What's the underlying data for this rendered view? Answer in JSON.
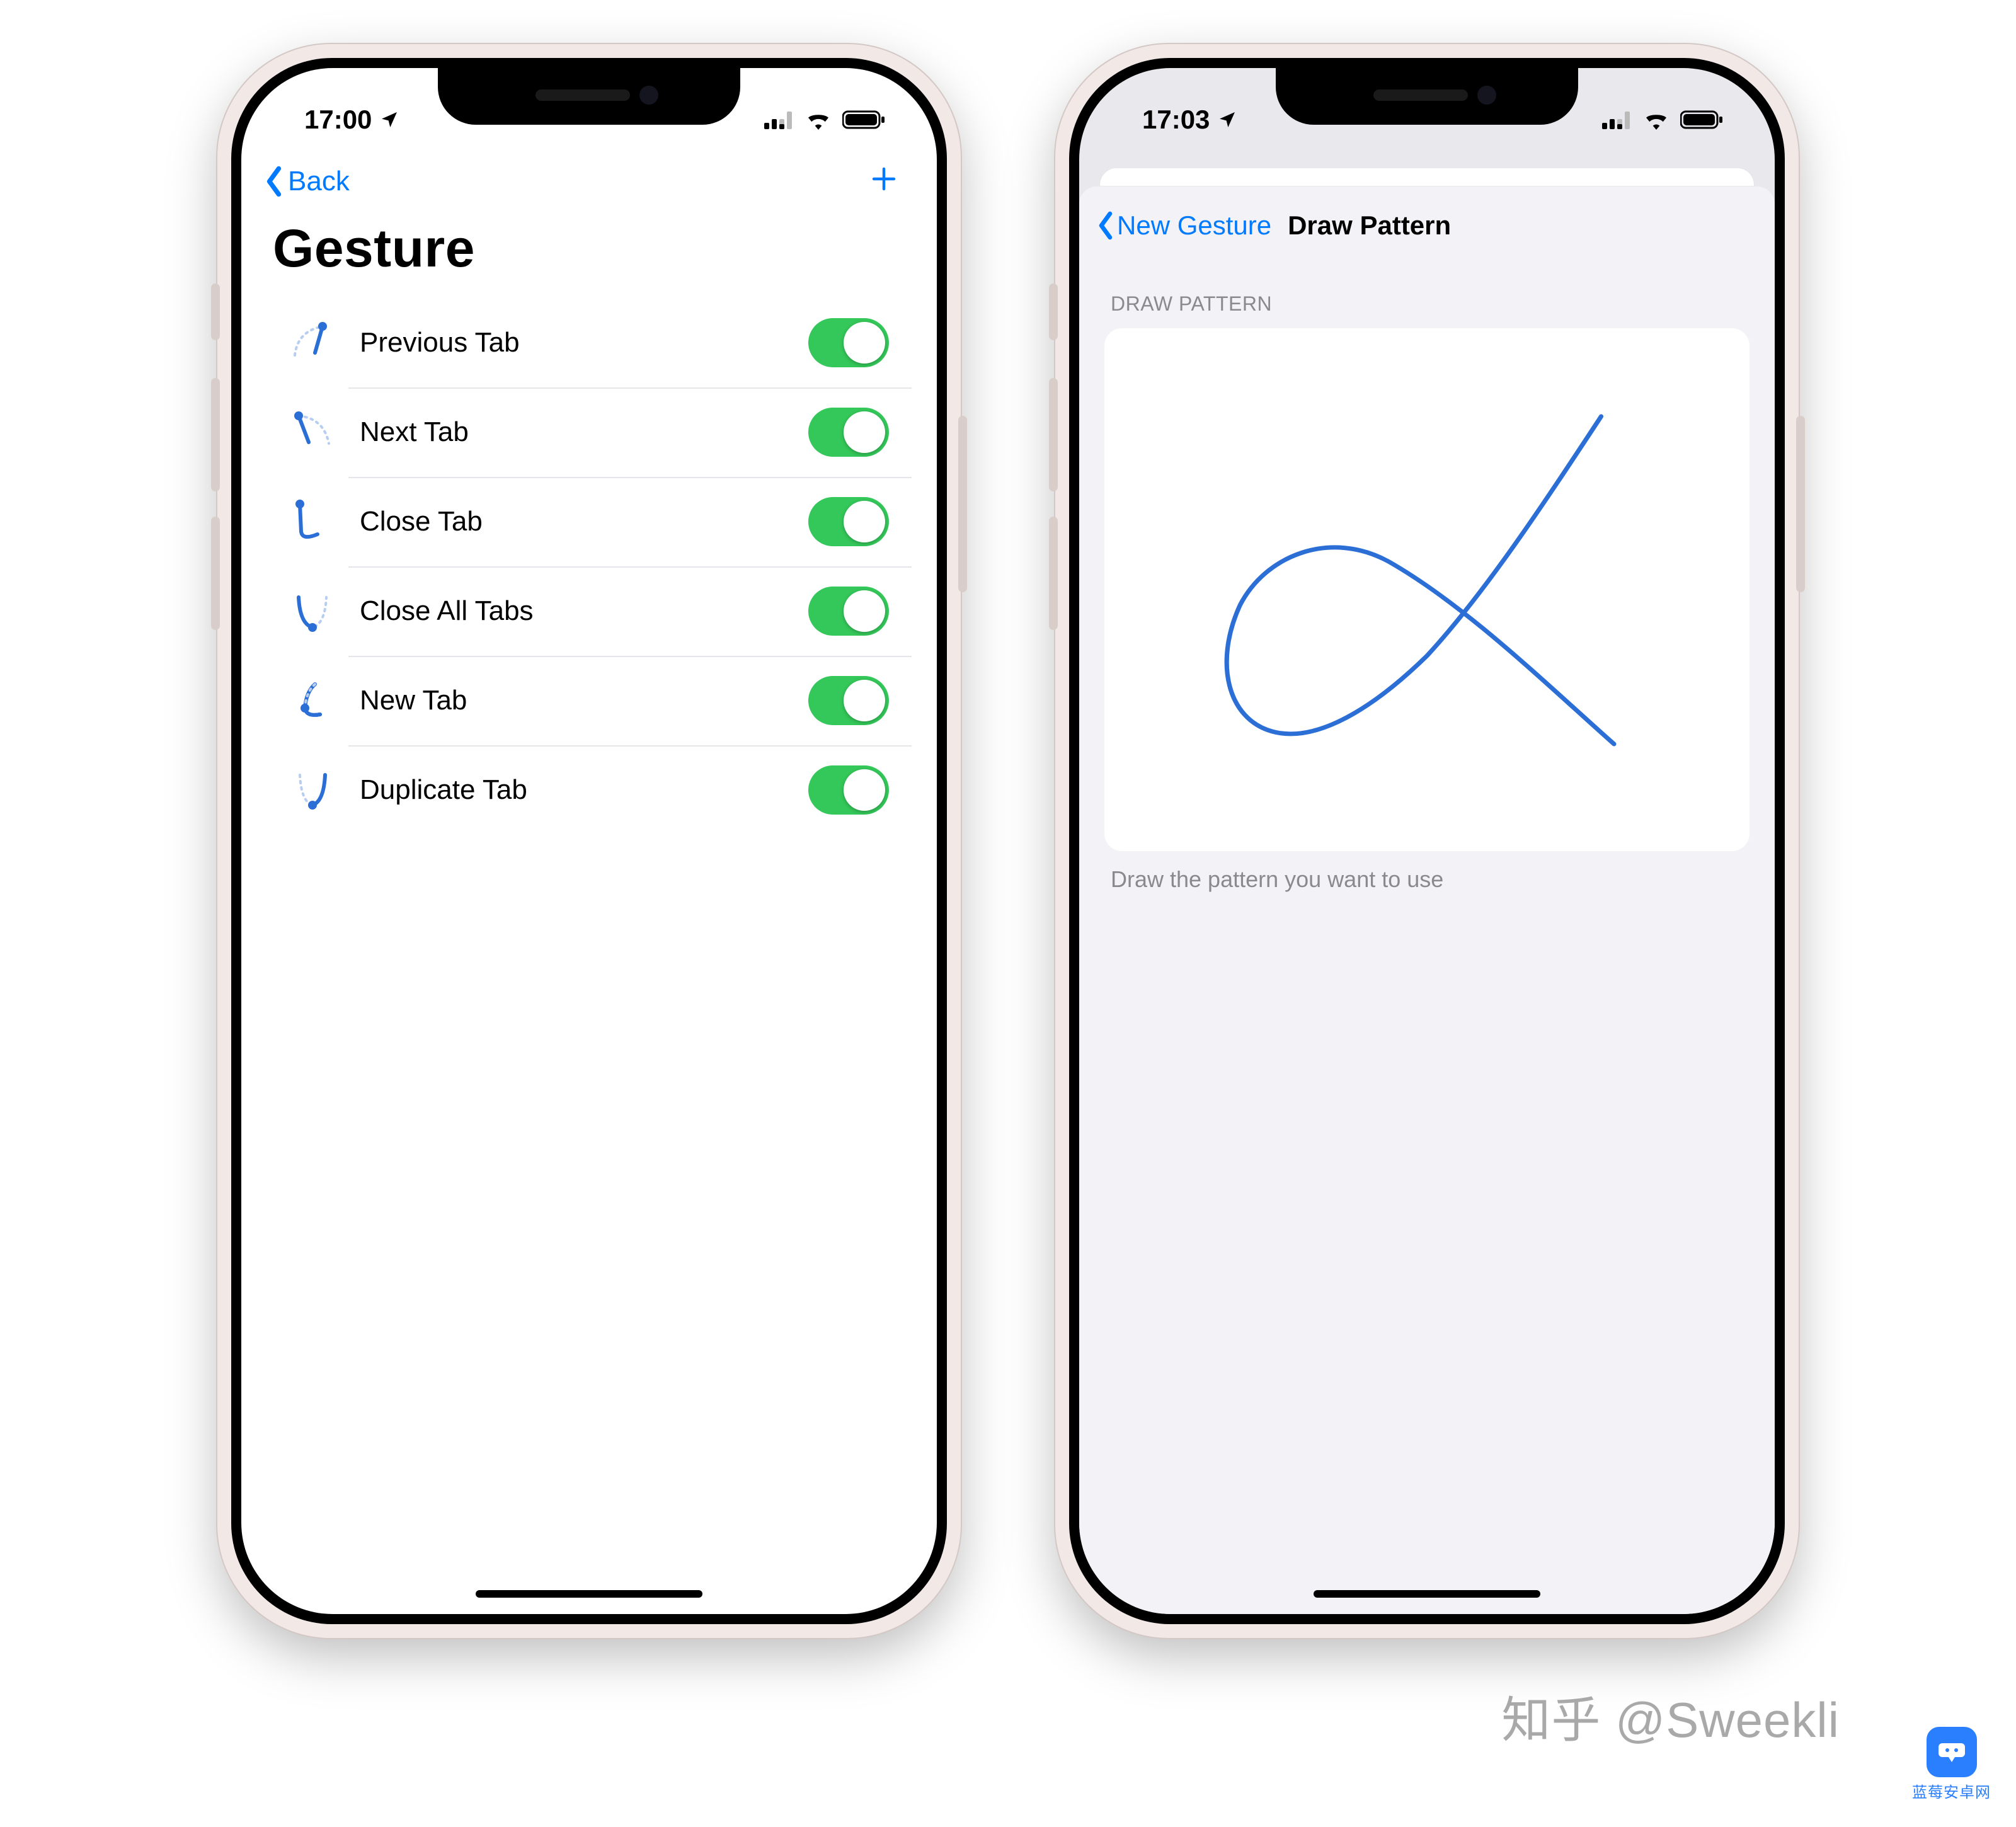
{
  "phone_left": {
    "status": {
      "time": "17:00"
    },
    "nav": {
      "back_label": "Back"
    },
    "title": "Gesture",
    "rows": [
      {
        "label": "Previous Tab",
        "enabled": true,
        "icon": "gesture-prev-tab"
      },
      {
        "label": "Next Tab",
        "enabled": true,
        "icon": "gesture-next-tab"
      },
      {
        "label": "Close Tab",
        "enabled": true,
        "icon": "gesture-close-tab"
      },
      {
        "label": "Close All Tabs",
        "enabled": true,
        "icon": "gesture-close-all-tabs"
      },
      {
        "label": "New Tab",
        "enabled": true,
        "icon": "gesture-new-tab"
      },
      {
        "label": "Duplicate Tab",
        "enabled": true,
        "icon": "gesture-duplicate-tab"
      }
    ]
  },
  "phone_right": {
    "status": {
      "time": "17:03"
    },
    "nav": {
      "back_label": "New Gesture",
      "title": "Draw Pattern"
    },
    "section_header": "DRAW PATTERN",
    "section_footer": "Draw the pattern you want to use"
  },
  "watermark": "知乎 @Sweekli",
  "corner_badge": "蓝莓安卓网",
  "colors": {
    "ios_blue": "#007aff",
    "toggle_green": "#34c759",
    "bg_grouped": "#f2f2f7",
    "gesture_stroke": "#2b6fd6"
  }
}
